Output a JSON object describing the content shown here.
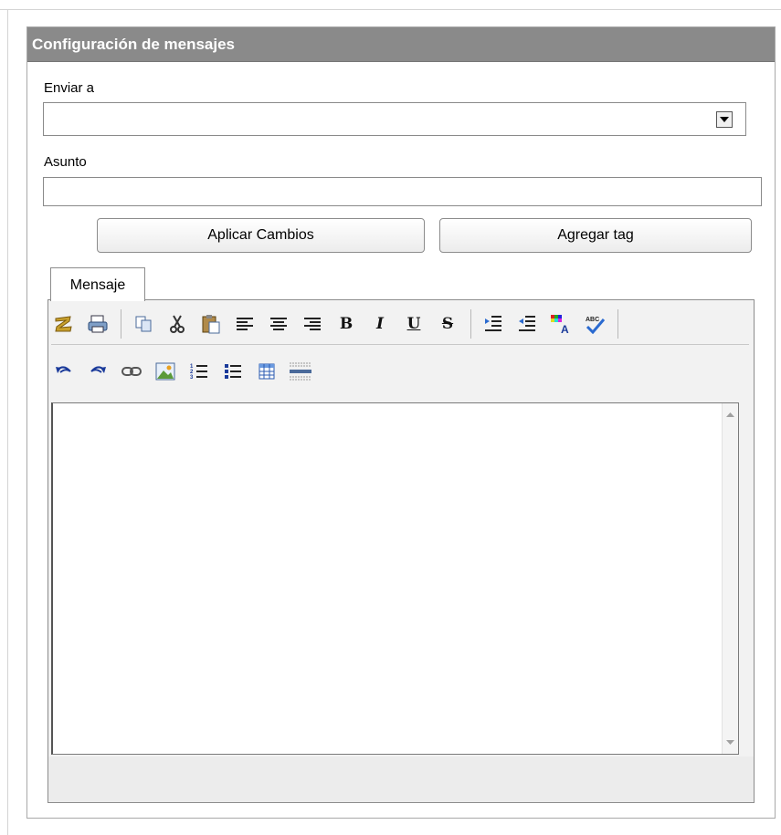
{
  "panel": {
    "title": "Configuración de mensajes"
  },
  "send_to": {
    "label": "Enviar a",
    "value": ""
  },
  "subject": {
    "label": "Asunto",
    "value": "",
    "placeholder": ""
  },
  "buttons": {
    "apply_changes": "Aplicar Cambios",
    "add_tag": "Agregar tag"
  },
  "editor": {
    "tab_label": "Mensaje",
    "toolbar_row1": [
      "new-document-icon",
      "print-icon",
      "copy-icon",
      "cut-icon",
      "paste-icon",
      "align-left-icon",
      "align-center-icon",
      "align-right-icon",
      "bold-icon",
      "italic-icon",
      "underline-icon",
      "strikethrough-icon",
      "indent-icon",
      "outdent-icon",
      "text-color-icon",
      "spellcheck-icon"
    ],
    "toolbar_row2": [
      "undo-icon",
      "redo-icon",
      "link-icon",
      "image-icon",
      "ordered-list-icon",
      "unordered-list-icon",
      "table-icon",
      "horizontal-rule-icon"
    ],
    "bold_glyph": "B",
    "italic_glyph": "I",
    "underline_glyph": "U",
    "strike_glyph": "S",
    "content": ""
  },
  "colors": {
    "header_bg": "#8a8a8a",
    "header_text": "#ffffff",
    "border": "#8c8c8c"
  }
}
